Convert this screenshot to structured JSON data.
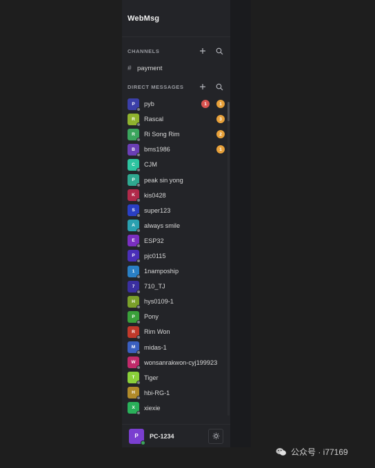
{
  "app": {
    "title": "WebMsg"
  },
  "channels": {
    "header": "CHANNELS",
    "items": [
      {
        "name": "payment"
      }
    ]
  },
  "direct_messages": {
    "header": "DIRECT MESSAGES",
    "items": [
      {
        "initial": "P",
        "name": "pyb",
        "color": "#3b3fa8",
        "badges": [
          {
            "value": "1",
            "type": "red"
          },
          {
            "value": "1",
            "type": "orange"
          }
        ]
      },
      {
        "initial": "R",
        "name": "Rascal",
        "color": "#8fb22e",
        "badges": [
          {
            "value": "3",
            "type": "orange"
          }
        ]
      },
      {
        "initial": "R",
        "name": "Ri Song Rim",
        "color": "#3ba55d",
        "badges": [
          {
            "value": "2",
            "type": "orange"
          }
        ]
      },
      {
        "initial": "B",
        "name": "bms1986",
        "color": "#6a3fb5",
        "badges": [
          {
            "value": "1",
            "type": "orange"
          }
        ]
      },
      {
        "initial": "C",
        "name": "CJM",
        "color": "#2ec4a0",
        "badges": []
      },
      {
        "initial": "P",
        "name": "peak sin yong",
        "color": "#2fa890",
        "badges": []
      },
      {
        "initial": "K",
        "name": "kis0428",
        "color": "#b02a4a",
        "badges": []
      },
      {
        "initial": "S",
        "name": "super123",
        "color": "#2a3fc4",
        "badges": []
      },
      {
        "initial": "A",
        "name": "always smile",
        "color": "#2aa0b0",
        "badges": []
      },
      {
        "initial": "E",
        "name": "ESP32",
        "color": "#7a2fc0",
        "badges": []
      },
      {
        "initial": "P",
        "name": "pjc0115",
        "color": "#4a2fb8",
        "badges": []
      },
      {
        "initial": "1",
        "name": "1nampoship",
        "color": "#2a7fc4",
        "badges": []
      },
      {
        "initial": "7",
        "name": "710_TJ",
        "color": "#3a2fa0",
        "badges": []
      },
      {
        "initial": "H",
        "name": "hys0109-1",
        "color": "#7aa02a",
        "badges": []
      },
      {
        "initial": "P",
        "name": "Pony",
        "color": "#3aa03a",
        "badges": []
      },
      {
        "initial": "R",
        "name": "Rim Won",
        "color": "#c0392b",
        "badges": []
      },
      {
        "initial": "M",
        "name": "midas-1",
        "color": "#3a5fc0",
        "badges": []
      },
      {
        "initial": "W",
        "name": "wonsanrakwon-cyj199923",
        "color": "#c02a6a",
        "badges": []
      },
      {
        "initial": "T",
        "name": "Tiger",
        "color": "#8ad03a",
        "badges": []
      },
      {
        "initial": "H",
        "name": "hbi-RG-1",
        "color": "#b08a2a",
        "badges": []
      },
      {
        "initial": "X",
        "name": "xiexie",
        "color": "#2ab05a",
        "badges": []
      }
    ]
  },
  "current_user": {
    "initial": "P",
    "name": "PC-1234",
    "color": "#7a3fd0"
  },
  "watermark": {
    "text": "公众号 · i77169"
  },
  "icons": {
    "add": "plus-icon",
    "search": "search-icon",
    "channel": "hash-icon",
    "theme": "sun-icon",
    "watermark": "wechat-icon"
  }
}
